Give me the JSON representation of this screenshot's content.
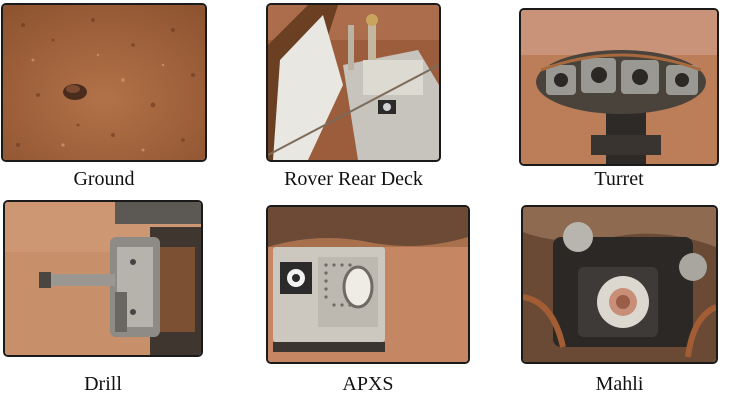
{
  "panels": [
    {
      "id": "ground",
      "caption": "Ground",
      "subject": "martian-ground-photo"
    },
    {
      "id": "rear-deck",
      "caption": "Rover Rear Deck",
      "subject": "rover-rear-deck-photo"
    },
    {
      "id": "turret",
      "caption": "Turret",
      "subject": "turret-photo"
    },
    {
      "id": "drill",
      "caption": "Drill",
      "subject": "drill-photo"
    },
    {
      "id": "apxs",
      "caption": "APXS",
      "subject": "apxs-photo"
    },
    {
      "id": "mahli",
      "caption": "Mahli",
      "subject": "mahli-photo"
    }
  ]
}
